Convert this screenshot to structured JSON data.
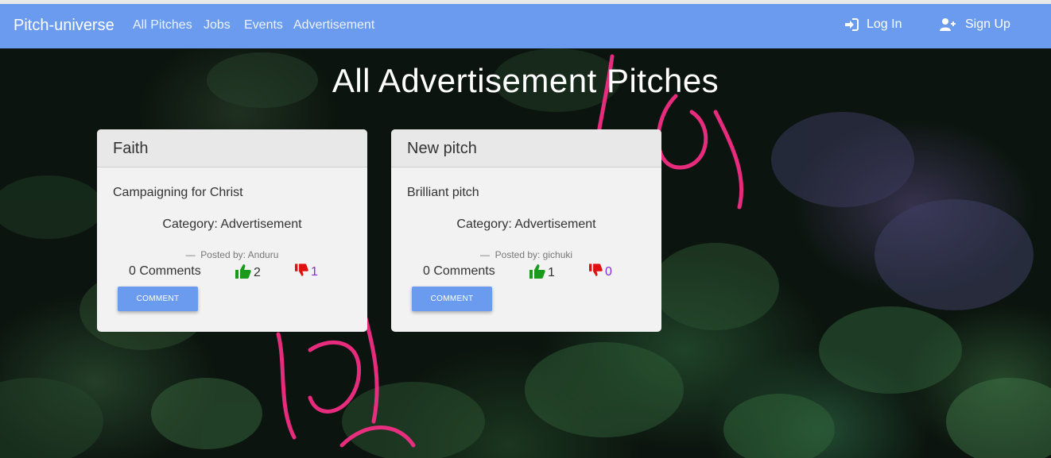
{
  "navbar": {
    "brand": "Pitch-universe",
    "links": [
      "All Pitches",
      "Jobs",
      "Events",
      "Advertisement"
    ],
    "login": "Log In",
    "signup": "Sign Up"
  },
  "page": {
    "title": "All Advertisement Pitches"
  },
  "cards": [
    {
      "title": "Faith",
      "description": "Campaigning for Christ",
      "category": "Category: Advertisement",
      "posted_by": "Posted by: Anduru",
      "comments": "0 Comments",
      "upvotes": "2",
      "downvotes": "1",
      "button": "COMMENT"
    },
    {
      "title": "New pitch",
      "description": "Brilliant pitch",
      "category": "Category: Advertisement",
      "posted_by": "Posted by: gichuki",
      "comments": "0 Comments",
      "upvotes": "1",
      "downvotes": "0",
      "button": "COMMENT"
    }
  ],
  "colors": {
    "navbar": "#6b9bee",
    "button": "#6b9bee",
    "upvote_icon": "#1a9a1a",
    "downvote_icon": "#e01010",
    "downvote_count": "#8a2be2",
    "neon": "#ff2e8a"
  },
  "icons": {
    "login": "sign-in-icon",
    "signup": "user-plus-icon",
    "upvote": "thumbs-up-icon",
    "downvote": "thumbs-down-icon"
  }
}
